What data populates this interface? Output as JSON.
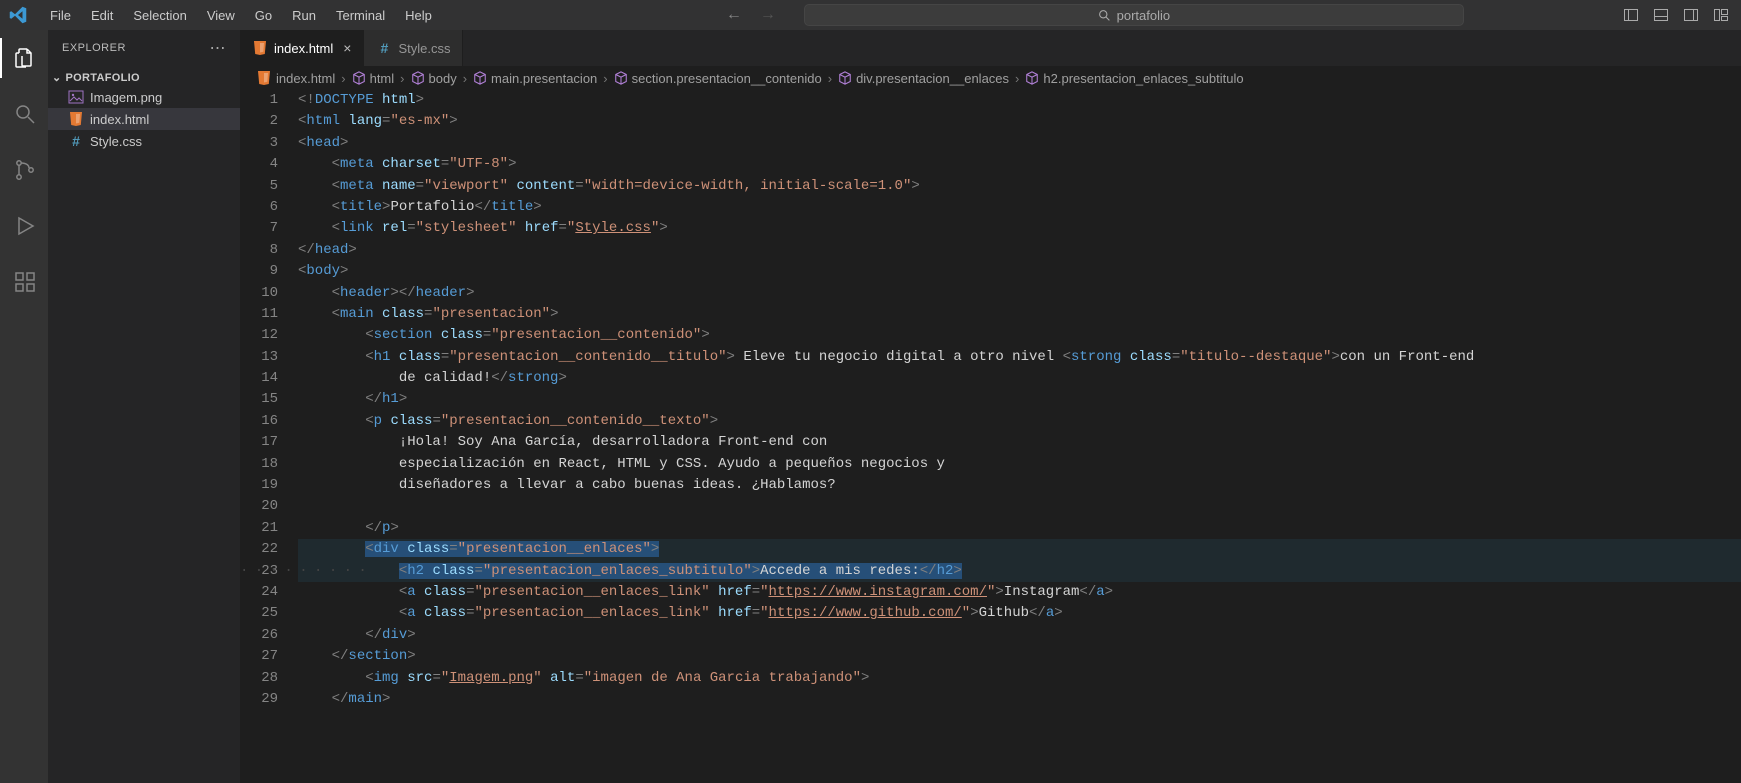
{
  "menu": {
    "file": "File",
    "edit": "Edit",
    "selection": "Selection",
    "view": "View",
    "go": "Go",
    "run": "Run",
    "terminal": "Terminal",
    "help": "Help"
  },
  "search": {
    "text": "portafolio"
  },
  "sidebar": {
    "title": "EXPLORER",
    "project": "PORTAFOLIO",
    "files": [
      {
        "name": "Imagem.png",
        "type": "image"
      },
      {
        "name": "index.html",
        "type": "html"
      },
      {
        "name": "Style.css",
        "type": "css"
      }
    ]
  },
  "tabs": [
    {
      "name": "index.html",
      "type": "html",
      "active": true,
      "close": true
    },
    {
      "name": "Style.css",
      "type": "css",
      "active": false,
      "close": false
    }
  ],
  "breadcrumbs": [
    {
      "label": "index.html",
      "icon": "html-file"
    },
    {
      "label": "html",
      "icon": "cube"
    },
    {
      "label": "body",
      "icon": "cube"
    },
    {
      "label": "main.presentacion",
      "icon": "cube"
    },
    {
      "label": "section.presentacion__contenido",
      "icon": "cube"
    },
    {
      "label": "div.presentacion__enlaces",
      "icon": "cube"
    },
    {
      "label": "h2.presentacion_enlaces_subtitulo",
      "icon": "cube"
    }
  ],
  "code": {
    "start_line": 1,
    "lines": [
      {
        "n": 1,
        "html": "<span class='c-punc'>&lt;</span><span class='c-punc'>!</span><span class='c-doctype'>DOCTYPE</span> <span class='c-doctype2'>html</span><span class='c-punc'>&gt;</span>"
      },
      {
        "n": 2,
        "html": "<span class='c-punc'>&lt;</span><span class='c-tag'>html</span> <span class='c-attr'>lang</span><span class='c-punc'>=</span><span class='c-str'>\"es-mx\"</span><span class='c-punc'>&gt;</span>"
      },
      {
        "n": 3,
        "html": "<span class='c-punc'>&lt;</span><span class='c-tag'>head</span><span class='c-punc'>&gt;</span>"
      },
      {
        "n": 4,
        "html": "    <span class='c-punc'>&lt;</span><span class='c-tag'>meta</span> <span class='c-attr'>charset</span><span class='c-punc'>=</span><span class='c-str'>\"UTF-8\"</span><span class='c-punc'>&gt;</span>"
      },
      {
        "n": 5,
        "html": "    <span class='c-punc'>&lt;</span><span class='c-tag'>meta</span> <span class='c-attr'>name</span><span class='c-punc'>=</span><span class='c-str'>\"viewport\"</span> <span class='c-attr'>content</span><span class='c-punc'>=</span><span class='c-str'>\"width=device-width, initial-scale=1.0\"</span><span class='c-punc'>&gt;</span>"
      },
      {
        "n": 6,
        "html": "    <span class='c-punc'>&lt;</span><span class='c-tag'>title</span><span class='c-punc'>&gt;</span>Portafolio<span class='c-punc'>&lt;/</span><span class='c-tag'>title</span><span class='c-punc'>&gt;</span>"
      },
      {
        "n": 7,
        "html": "    <span class='c-punc'>&lt;</span><span class='c-tag'>link</span> <span class='c-attr'>rel</span><span class='c-punc'>=</span><span class='c-str'>\"stylesheet\"</span> <span class='c-attr'>href</span><span class='c-punc'>=</span><span class='c-str'>\"<span class='c-link'>Style.css</span>\"</span><span class='c-punc'>&gt;</span>"
      },
      {
        "n": 8,
        "html": "<span class='c-punc'>&lt;/</span><span class='c-tag'>head</span><span class='c-punc'>&gt;</span>"
      },
      {
        "n": 9,
        "html": "<span class='c-punc'>&lt;</span><span class='c-tag'>body</span><span class='c-punc'>&gt;</span>"
      },
      {
        "n": 10,
        "html": "    <span class='c-punc'>&lt;</span><span class='c-tag'>header</span><span class='c-punc'>&gt;&lt;/</span><span class='c-tag'>header</span><span class='c-punc'>&gt;</span>"
      },
      {
        "n": 11,
        "html": "    <span class='c-punc'>&lt;</span><span class='c-tag'>main</span> <span class='c-attr'>class</span><span class='c-punc'>=</span><span class='c-str'>\"presentacion\"</span><span class='c-punc'>&gt;</span>"
      },
      {
        "n": 12,
        "html": "        <span class='c-punc'>&lt;</span><span class='c-tag'>section</span> <span class='c-attr'>class</span><span class='c-punc'>=</span><span class='c-str'>\"presentacion__contenido\"</span><span class='c-punc'>&gt;</span>"
      },
      {
        "n": 13,
        "html": "        <span class='c-punc'>&lt;</span><span class='c-tag'>h1</span> <span class='c-attr'>class</span><span class='c-punc'>=</span><span class='c-str'>\"presentacion__contenido__titulo\"</span><span class='c-punc'>&gt;</span> Eleve tu negocio digital a otro nivel <span class='c-punc'>&lt;</span><span class='c-tag'>strong</span> <span class='c-attr'>class</span><span class='c-punc'>=</span><span class='c-str'>\"titulo--destaque\"</span><span class='c-punc'>&gt;</span>con un Front-end"
      },
      {
        "n": 14,
        "html": "            de calidad!<span class='c-punc'>&lt;/</span><span class='c-tag'>strong</span><span class='c-punc'>&gt;</span>"
      },
      {
        "n": 15,
        "html": "        <span class='c-punc'>&lt;/</span><span class='c-tag'>h1</span><span class='c-punc'>&gt;</span>"
      },
      {
        "n": 16,
        "html": "        <span class='c-punc'>&lt;</span><span class='c-tag'>p</span> <span class='c-attr'>class</span><span class='c-punc'>=</span><span class='c-str'>\"presentacion__contenido__texto\"</span><span class='c-punc'>&gt;</span>"
      },
      {
        "n": 17,
        "html": "            ¡Hola! Soy Ana García, desarrolladora Front-end con"
      },
      {
        "n": 18,
        "html": "            especialización en React, HTML y CSS. Ayudo a pequeños negocios y"
      },
      {
        "n": 19,
        "html": "            diseñadores a llevar a cabo buenas ideas. ¿Hablamos?"
      },
      {
        "n": 20,
        "html": ""
      },
      {
        "n": 21,
        "html": "        <span class='c-punc'>&lt;/</span><span class='c-tag'>p</span><span class='c-punc'>&gt;</span>"
      },
      {
        "n": 22,
        "hl": true,
        "html": "        <span class='sel-bg'><span class='c-punc'>&lt;</span><span class='c-tag'>div</span> <span class='c-attr'>class</span><span class='c-punc'>=</span><span class='c-str'>\"presentacion__enlaces\"</span><span class='c-punc'>&gt;</span></span>"
      },
      {
        "n": 23,
        "hl": true,
        "dotted": true,
        "html": "            <span class='sel-bg'><span class='c-punc'>&lt;</span><span class='c-tag'>h2</span> <span class='c-attr'>class</span><span class='c-punc'>=</span><span class='c-str'>\"presentacion_enlaces_subtitulo\"</span><span class='c-punc'>&gt;</span>Accede a mis redes:<span class='c-punc'>&lt;/</span><span class='c-tag'>h2</span><span class='c-punc'>&gt;</span></span>"
      },
      {
        "n": 24,
        "html": "            <span class='c-punc'>&lt;</span><span class='c-tag'>a</span> <span class='c-attr'>class</span><span class='c-punc'>=</span><span class='c-str'>\"presentacion__enlaces_link\"</span> <span class='c-attr'>href</span><span class='c-punc'>=</span><span class='c-str'>\"<span class='c-link'>https://www.instagram.com/</span>\"</span><span class='c-punc'>&gt;</span>Instagram<span class='c-punc'>&lt;/</span><span class='c-tag'>a</span><span class='c-punc'>&gt;</span>"
      },
      {
        "n": 25,
        "html": "            <span class='c-punc'>&lt;</span><span class='c-tag'>a</span> <span class='c-attr'>class</span><span class='c-punc'>=</span><span class='c-str'>\"presentacion__enlaces_link\"</span> <span class='c-attr'>href</span><span class='c-punc'>=</span><span class='c-str'>\"<span class='c-link'>https://www.github.com/</span>\"</span><span class='c-punc'>&gt;</span>Github<span class='c-punc'>&lt;/</span><span class='c-tag'>a</span><span class='c-punc'>&gt;</span>"
      },
      {
        "n": 26,
        "html": "        <span class='c-punc'>&lt;/</span><span class='c-tag'>div</span><span class='c-punc'>&gt;</span>"
      },
      {
        "n": 27,
        "html": "    <span class='c-punc'>&lt;/</span><span class='c-tag'>section</span><span class='c-punc'>&gt;</span>"
      },
      {
        "n": 28,
        "html": "        <span class='c-punc'>&lt;</span><span class='c-tag'>img</span> <span class='c-attr'>src</span><span class='c-punc'>=</span><span class='c-str'>\"<span class='c-link'>Imagem.png</span>\"</span> <span class='c-attr'>alt</span><span class='c-punc'>=</span><span class='c-str'>\"imagen de Ana Garcia trabajando\"</span><span class='c-punc'>&gt;</span>"
      },
      {
        "n": 29,
        "html": "    <span class='c-punc'>&lt;/</span><span class='c-tag'>main</span><span class='c-punc'>&gt;</span>"
      }
    ]
  }
}
